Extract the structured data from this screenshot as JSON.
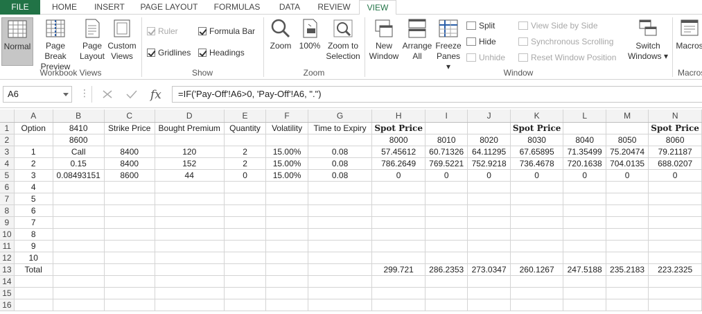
{
  "tabs": [
    "FILE",
    "HOME",
    "INSERT",
    "PAGE LAYOUT",
    "FORMULAS",
    "DATA",
    "REVIEW",
    "VIEW"
  ],
  "ribbon": {
    "workbook_views": {
      "label": "Workbook Views",
      "normal": "Normal",
      "page_break_1": "Page Break",
      "page_break_2": "Preview",
      "page_layout_1": "Page",
      "page_layout_2": "Layout",
      "custom_1": "Custom",
      "custom_2": "Views"
    },
    "show": {
      "label": "Show",
      "ruler": "Ruler",
      "formula_bar": "Formula Bar",
      "gridlines": "Gridlines",
      "headings": "Headings"
    },
    "zoom": {
      "label": "Zoom",
      "zoom": "Zoom",
      "hundred": "100%",
      "zoom_sel_1": "Zoom to",
      "zoom_sel_2": "Selection"
    },
    "window": {
      "label": "Window",
      "new_1": "New",
      "new_2": "Window",
      "arrange_1": "Arrange",
      "arrange_2": "All",
      "freeze_1": "Freeze",
      "freeze_2": "Panes ▾",
      "split": "Split",
      "hide": "Hide",
      "unhide": "Unhide",
      "side_by_side": "View Side by Side",
      "sync_scroll": "Synchronous Scrolling",
      "reset_pos": "Reset Window Position",
      "switch_1": "Switch",
      "switch_2": "Windows ▾"
    },
    "macros": {
      "label": "Macros",
      "macros": "Macros"
    }
  },
  "formula_bar": {
    "name_box": "A6",
    "dots": "⋮",
    "formula": "=IF('Pay-Off'!A6>0, 'Pay-Off'!A6, \".\")"
  },
  "columns": [
    "A",
    "B",
    "C",
    "D",
    "E",
    "F",
    "G",
    "H",
    "I",
    "J",
    "K",
    "L",
    "M",
    "N"
  ],
  "rows": [
    [
      "Option",
      "8410",
      "Strike Price",
      "Bought Premium",
      "Quantity",
      "Volatility",
      "Time to Expiry",
      "Spot Price",
      "",
      "",
      "Spot Price",
      "",
      "",
      "Spot Price"
    ],
    [
      "",
      "8600",
      "",
      "",
      "",
      "",
      "",
      "8000",
      "8010",
      "8020",
      "8030",
      "8040",
      "8050",
      "8060"
    ],
    [
      "1",
      "Call",
      "8400",
      "120",
      "2",
      "15.00%",
      "0.08",
      "57.45612",
      "60.71326",
      "64.11295",
      "67.65895",
      "71.35499",
      "75.20474",
      "79.21187"
    ],
    [
      "2",
      "0.15",
      "8400",
      "152",
      "2",
      "15.00%",
      "0.08",
      "786.2649",
      "769.5221",
      "752.9218",
      "736.4678",
      "720.1638",
      "704.0135",
      "688.0207"
    ],
    [
      "3",
      "0.08493151",
      "8600",
      "44",
      "0",
      "15.00%",
      "0.08",
      "0",
      "0",
      "0",
      "0",
      "0",
      "0",
      "0"
    ],
    [
      "4",
      "",
      "",
      "",
      "",
      "",
      "",
      "",
      "",
      "",
      "",
      "",
      "",
      ""
    ],
    [
      "5",
      "",
      "",
      "",
      "",
      "",
      "",
      "",
      "",
      "",
      "",
      "",
      "",
      ""
    ],
    [
      "6",
      "",
      "",
      "",
      "",
      "",
      "",
      "",
      "",
      "",
      "",
      "",
      "",
      ""
    ],
    [
      "7",
      "",
      "",
      "",
      "",
      "",
      "",
      "",
      "",
      "",
      "",
      "",
      "",
      ""
    ],
    [
      "8",
      "",
      "",
      "",
      "",
      "",
      "",
      "",
      "",
      "",
      "",
      "",
      "",
      ""
    ],
    [
      "9",
      "",
      "",
      "",
      "",
      "",
      "",
      "",
      "",
      "",
      "",
      "",
      "",
      ""
    ],
    [
      "10",
      "",
      "",
      "",
      "",
      "",
      "",
      "",
      "",
      "",
      "",
      "",
      "",
      ""
    ],
    [
      "Total",
      "",
      "",
      "",
      "",
      "",
      "",
      "299.721",
      "286.2353",
      "273.0347",
      "260.1267",
      "247.5188",
      "235.2183",
      "223.2325"
    ],
    [
      "",
      "",
      "",
      "",
      "",
      "",
      "",
      "",
      "",
      "",
      "",
      "",
      "",
      ""
    ],
    [
      "",
      "",
      "",
      "",
      "",
      "",
      "",
      "",
      "",
      "",
      "",
      "",
      "",
      ""
    ],
    [
      "",
      "",
      "",
      "",
      "",
      "",
      "",
      "",
      "",
      "",
      "",
      "",
      "",
      ""
    ]
  ],
  "row_numbers": [
    "1",
    "2",
    "3",
    "4",
    "5",
    "6",
    "7",
    "8",
    "9",
    "10",
    "11",
    "12",
    "13",
    "14",
    "15",
    "16"
  ],
  "colors": {
    "excel_green": "#217346",
    "grid_line": "#d4d4d4",
    "header_bg": "#f3f3f3"
  }
}
